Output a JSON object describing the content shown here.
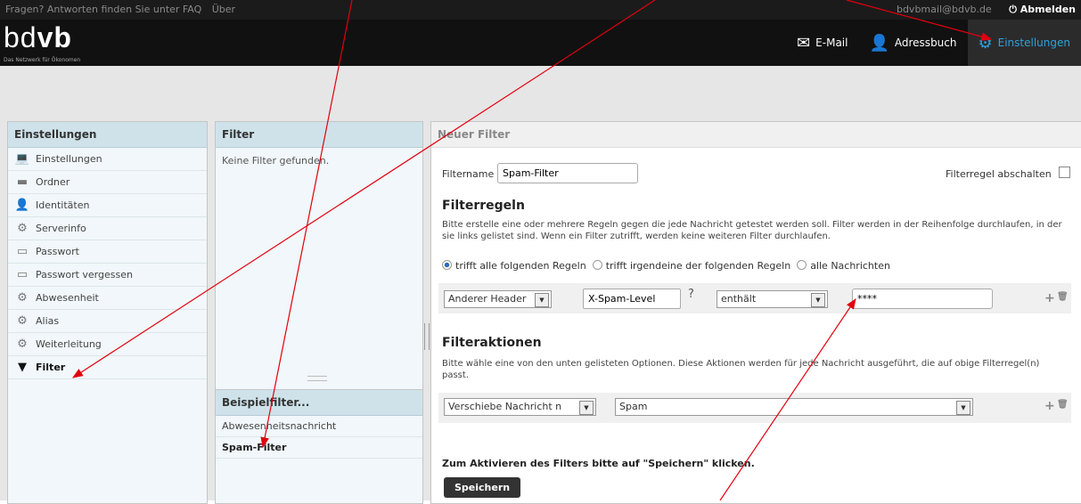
{
  "topbar": {
    "faq_text": "Fragen? Antworten finden Sie unter FAQ",
    "about": "Über",
    "email": "bdvbmail@bdvb.de",
    "logout": "Abmelden"
  },
  "brand": {
    "logo_light": "bd",
    "logo_bold": "vb",
    "tagline": "Das Netzwerk für Ökonomen"
  },
  "nav": [
    {
      "label": "E-Mail",
      "icon": "mail-icon"
    },
    {
      "label": "Adressbuch",
      "icon": "person-icon"
    },
    {
      "label": "Einstellungen",
      "icon": "gear-icon"
    }
  ],
  "settings_panel": {
    "title": "Einstellungen",
    "items": [
      {
        "label": "Einstellungen",
        "icon": "laptop-icon"
      },
      {
        "label": "Ordner",
        "icon": "folder-icon"
      },
      {
        "label": "Identitäten",
        "icon": "person-icon"
      },
      {
        "label": "Serverinfo",
        "icon": "gear-icon"
      },
      {
        "label": "Passwort",
        "icon": "password-icon"
      },
      {
        "label": "Passwort vergessen",
        "icon": "password-icon"
      },
      {
        "label": "Abwesenheit",
        "icon": "gear-icon"
      },
      {
        "label": "Alias",
        "icon": "gear-icon"
      },
      {
        "label": "Weiterleitung",
        "icon": "gear-icon"
      },
      {
        "label": "Filter",
        "icon": "funnel-icon"
      }
    ]
  },
  "filter_panel": {
    "title": "Filter",
    "empty": "Keine Filter gefunden."
  },
  "example_panel": {
    "title": "Beispielfilter...",
    "items": [
      "Abwesenheitsnachricht",
      "Spam-Filter"
    ]
  },
  "editor": {
    "title": "Neuer Filter",
    "filtername_label": "Filtername",
    "filtername_value": "Spam-Filter",
    "disable_label": "Filterregel abschalten",
    "rules_heading": "Filterregeln",
    "rules_desc": "Bitte erstelle eine oder mehrere Regeln gegen die jede Nachricht getestet werden soll. Filter werden in der Reihenfolge durchlaufen, in der sie links gelistet sind. Wenn ein Filter zutrifft, werden keine weiteren Filter durchlaufen.",
    "radio_all": "trifft alle folgenden Regeln",
    "radio_any": "trifft irgendeine der folgenden Regeln",
    "radio_every": "alle Nachrichten",
    "rule_header": "Anderer Header",
    "rule_header_name": "X-Spam-Level",
    "rule_help": "?",
    "rule_op": "enthält",
    "rule_value": "****",
    "actions_heading": "Filteraktionen",
    "actions_desc": "Bitte wähle eine von den unten gelisteten Optionen. Diese Aktionen werden für jede Nachricht ausgeführt, die auf obige Filterregel(n) passt.",
    "action_type": "Verschiebe Nachricht n",
    "action_target": "Spam",
    "activate_hint": "Zum Aktivieren des Filters bitte auf \"Speichern\" klicken.",
    "save": "Speichern",
    "add": "+",
    "trash": "🗑"
  },
  "colors": {
    "accent": "#2ea2dd",
    "arrow": "#e3000f"
  }
}
